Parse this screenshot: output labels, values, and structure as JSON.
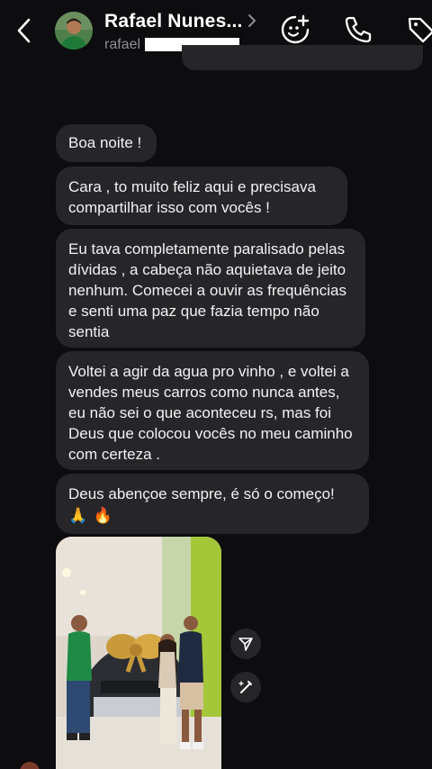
{
  "header": {
    "contact_name": "Rafael Nunes...",
    "username": "rafael",
    "icons": [
      "back-chevron-icon",
      "avatar",
      "chevron-right-icon",
      "sticker-add-icon",
      "phone-icon",
      "tag-icon"
    ]
  },
  "messages": [
    {
      "text": "Boa noite !"
    },
    {
      "text": "Cara , to muito feliz aqui e precisava compartilhar isso com vocês !"
    },
    {
      "text": "Eu tava completamente paralisado pelas dívidas , a cabeça não aquietava de jeito nenhum. Comecei a ouvir as frequências e senti uma paz que fazia tempo não sentia"
    },
    {
      "text": "Voltei a agir da agua pro vinho , e voltei a vendes meus carros como nunca antes, eu não sei o que aconteceu rs, mas foi Deus que colocou vocês no meu caminho com certeza ."
    },
    {
      "text": "Deus abençoe sempre, é só o começo!",
      "emojis": [
        "🙏",
        "🔥"
      ]
    }
  ],
  "photo": {
    "kind": "photo of three people with a car and gold bow in a dealership"
  },
  "side_actions": [
    "share-icon",
    "magic-edit-icon"
  ],
  "colors": {
    "background": "#0d0d0f",
    "bubble": "#262629",
    "text": "#f2f2f2",
    "muted": "#8e8e93",
    "accent_green": "#a4c639"
  }
}
